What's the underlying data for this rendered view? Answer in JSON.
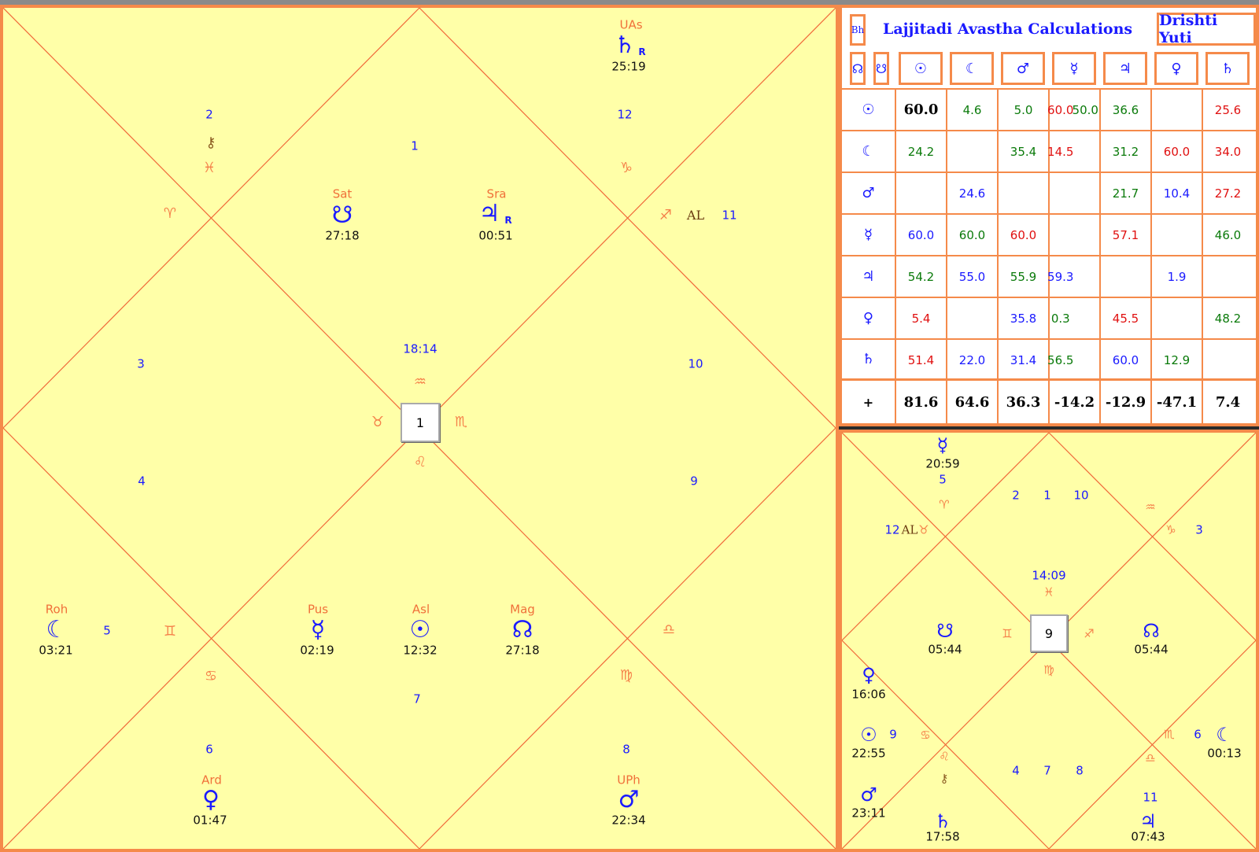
{
  "main_chart": {
    "house_numbers": [
      "1",
      "2",
      "12",
      "11",
      "3",
      "10",
      "4",
      "9",
      "5",
      "7",
      "6",
      "8"
    ],
    "zodiac_glyphs": {
      "aries": "♈",
      "pisces": "♓",
      "capricorn": "♑",
      "sagittarius": "♐",
      "aquarius": "♒",
      "taurus": "♉",
      "scorpio": "♏",
      "leo": "♌",
      "gemini": "♊",
      "libra": "♎",
      "cancer": "♋",
      "virgo": "♍"
    },
    "center_degree": "18:14",
    "center_box": "1",
    "al_label": "AL",
    "planets": {
      "saturn_top": {
        "nak": "UAs",
        "glyph": "♄",
        "retro": "R",
        "deg": "25:19"
      },
      "ketu": {
        "nak": "Sat",
        "glyph": "☋",
        "deg": "27:18"
      },
      "jupiter": {
        "nak": "Sra",
        "glyph": "♃",
        "retro": "R",
        "deg": "00:51"
      },
      "moon": {
        "nak": "Roh",
        "glyph": "☾",
        "deg": "03:21"
      },
      "mercury": {
        "nak": "Pus",
        "glyph": "☿",
        "deg": "02:19"
      },
      "sun": {
        "nak": "Asl",
        "glyph": "☉",
        "deg": "12:32"
      },
      "rahu": {
        "nak": "Mag",
        "glyph": "☊",
        "deg": "27:18"
      },
      "venus": {
        "nak": "Ard",
        "glyph": "♀",
        "deg": "01:47"
      },
      "mars": {
        "nak": "UPh",
        "glyph": "♂",
        "deg": "22:34"
      },
      "chiron_glyph": "⚷",
      "pluto_glyph": "♅"
    }
  },
  "avastha": {
    "bh_label": "Bh",
    "title": "Lajjitadi Avastha Calculations",
    "drishti_label": "Drishti Yuti",
    "col_icons": [
      "☊",
      "☋",
      "☉",
      "☾",
      "♂",
      "☿",
      "♃",
      "♀",
      "♄"
    ],
    "row_icons": [
      "☉",
      "☾",
      "♂",
      "☿",
      "♃",
      "♀",
      "♄",
      "+"
    ],
    "rows": [
      [
        {
          "v": "60.0",
          "c": "black bold"
        },
        {
          "v": "4.6",
          "c": "green"
        },
        {
          "v": "5.0",
          "c": "green"
        },
        {
          "v": "60.0",
          "c": "red"
        },
        {
          "v": "50.0",
          "c": "green"
        },
        {
          "v": "36.6",
          "c": "green"
        },
        {
          "v": "",
          "c": ""
        },
        {
          "v": "25.6",
          "c": "red"
        }
      ],
      [
        {
          "v": "24.2",
          "c": "green"
        },
        {
          "v": "",
          "c": ""
        },
        {
          "v": "35.4",
          "c": "green"
        },
        {
          "v": "14.5",
          "c": "red"
        },
        {
          "v": "",
          "c": ""
        },
        {
          "v": "31.2",
          "c": "green"
        },
        {
          "v": "60.0",
          "c": "red"
        },
        {
          "v": "34.0",
          "c": "red"
        }
      ],
      [
        {
          "v": "",
          "c": ""
        },
        {
          "v": "24.6",
          "c": "blue"
        },
        {
          "v": "",
          "c": ""
        },
        {
          "v": "",
          "c": ""
        },
        {
          "v": "",
          "c": ""
        },
        {
          "v": "21.7",
          "c": "green"
        },
        {
          "v": "10.4",
          "c": "blue"
        },
        {
          "v": "27.2",
          "c": "red"
        }
      ],
      [
        {
          "v": "60.0",
          "c": "blue"
        },
        {
          "v": "60.0",
          "c": "green"
        },
        {
          "v": "60.0",
          "c": "red"
        },
        {
          "v": "",
          "c": ""
        },
        {
          "v": "",
          "c": ""
        },
        {
          "v": "57.1",
          "c": "red"
        },
        {
          "v": "",
          "c": ""
        },
        {
          "v": "46.0",
          "c": "green"
        }
      ],
      [
        {
          "v": "54.2",
          "c": "green"
        },
        {
          "v": "55.0",
          "c": "blue"
        },
        {
          "v": "55.9",
          "c": "green"
        },
        {
          "v": "59.3",
          "c": "blue"
        },
        {
          "v": "",
          "c": ""
        },
        {
          "v": "",
          "c": ""
        },
        {
          "v": "1.9",
          "c": "blue"
        },
        {
          "v": "",
          "c": ""
        }
      ],
      [
        {
          "v": "5.4",
          "c": "red"
        },
        {
          "v": "",
          "c": ""
        },
        {
          "v": "35.8",
          "c": "blue"
        },
        {
          "v": "0.3",
          "c": "green"
        },
        {
          "v": "",
          "c": ""
        },
        {
          "v": "45.5",
          "c": "red"
        },
        {
          "v": "",
          "c": ""
        },
        {
          "v": "48.2",
          "c": "green"
        }
      ],
      [
        {
          "v": "51.4",
          "c": "red"
        },
        {
          "v": "22.0",
          "c": "blue"
        },
        {
          "v": "31.4",
          "c": "blue"
        },
        {
          "v": "56.5",
          "c": "green"
        },
        {
          "v": "",
          "c": ""
        },
        {
          "v": "60.0",
          "c": "blue"
        },
        {
          "v": "12.9",
          "c": "green"
        },
        {
          "v": "",
          "c": ""
        }
      ]
    ],
    "totals": [
      "81.6",
      "64.6",
      "36.3",
      "-14.2",
      "-12.9",
      "-47.1",
      "7.4"
    ]
  },
  "small_chart": {
    "center_box": "9",
    "center_degree": "14:09",
    "al_label": "AL",
    "house_numbers": [
      "5",
      "2",
      "1",
      "10",
      "12",
      "3",
      "9",
      "6",
      "4",
      "7",
      "8",
      "11"
    ],
    "degs": {
      "mercury": "20:59",
      "ketu": "05:44",
      "rahu": "05:44",
      "venus": "16:06",
      "sun": "22:55",
      "moon": "00:13",
      "mars": "23:11",
      "saturn": "17:58",
      "jupiter": "07:43"
    }
  },
  "colors": {
    "background": "#ffffa8",
    "border": "#f58a4a",
    "lines": "#f06a3a",
    "planet": "#1a1aff"
  }
}
